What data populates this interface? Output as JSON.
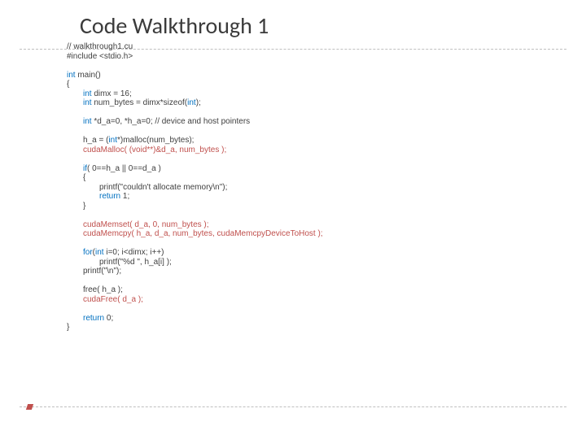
{
  "title": "Code Walkthrough 1",
  "code": {
    "c1": "// walkthrough1.cu",
    "c2": "#include <stdio.h>",
    "c3a": "int",
    "c3b": " main()",
    "c4": "{",
    "c5a": "int",
    "c5b": " dimx = 16;",
    "c6a": "int",
    "c6b": " num_bytes = dimx*sizeof(",
    "c6c": "int",
    "c6d": ");",
    "c7a": "int",
    "c7b": " *d_a=0, *h_a=0; // device and host pointers",
    "c8a": "h_a = (",
    "c8b": "int",
    "c8c": "*)malloc(num_bytes);",
    "c9a": "cudaMalloc( (",
    "c9b": "void",
    "c9c": "**)&d_a, num_bytes );",
    "c10a": "if",
    "c10b": "( 0==h_a || 0==d_a )",
    "c11": "{",
    "c12": "printf(\"couldn't allocate memory\\n\");",
    "c13a": "return",
    "c13b": " 1;",
    "c14": "}",
    "c15": "cudaMemset( d_a, 0, num_bytes );",
    "c16": "cudaMemcpy( h_a, d_a, num_bytes, cudaMemcpyDeviceToHost );",
    "c17a": "for",
    "c17b": "(",
    "c17c": "int",
    "c17d": " i=0; i<dimx; i++)",
    "c18": "printf(\"%d \", h_a[i] );",
    "c19": "printf(\"\\n\");",
    "c20": "free( h_a );",
    "c21": "cudaFree( d_a );",
    "c22a": "return",
    "c22b": " 0;",
    "c23": "}"
  }
}
